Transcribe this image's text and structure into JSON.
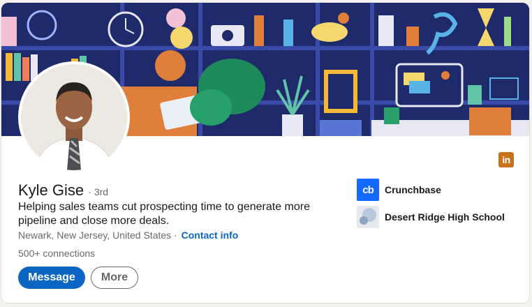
{
  "profile": {
    "name": "Kyle Gise",
    "degree": "3rd",
    "headline": "Helping sales teams cut prospecting time to generate more pipeline and close more deals.",
    "location": "Newark, New Jersey, United States",
    "contact_label": "Contact info",
    "connections": "500+ connections"
  },
  "actions": {
    "message_label": "Message",
    "more_label": "More"
  },
  "organizations": [
    {
      "name": "Crunchbase",
      "logo_text": "cb",
      "logo_color": "#146aff"
    },
    {
      "name": "Desert Ridge High School",
      "logo_color": "#b9c9dc"
    }
  ],
  "colors": {
    "accent": "#0a66c2",
    "linkedin_badge": "#c8731c",
    "banner_bg": "#1f2a6b"
  },
  "icons": {
    "badge": "linkedin-icon"
  }
}
